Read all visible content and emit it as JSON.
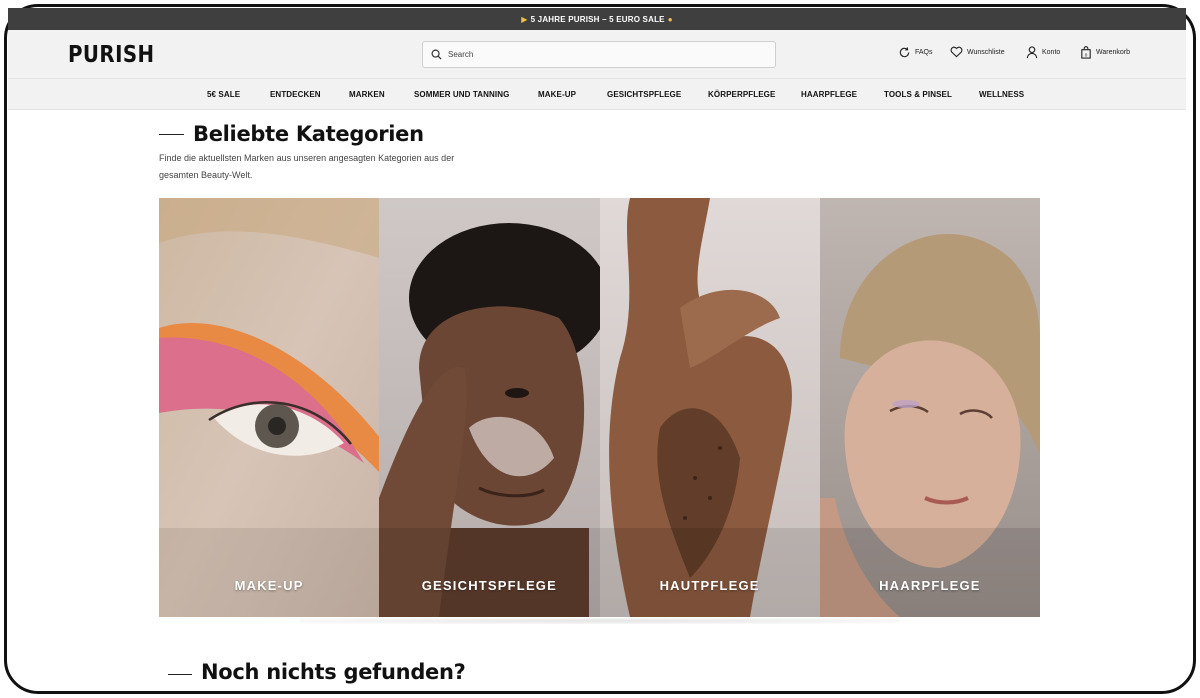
{
  "announcement": {
    "text": "5 JAHRE PURISH – 5 EURO SALE",
    "left_icon": "party-popper-icon",
    "right_icon": "money-icon"
  },
  "header": {
    "logo": "PURISH",
    "search": {
      "placeholder": "Search",
      "value": ""
    },
    "utilities": [
      {
        "label": "FAQs",
        "icon": "refresh-chat-icon"
      },
      {
        "label": "Wunschliste",
        "icon": "heart-icon"
      },
      {
        "label": "Konto",
        "icon": "user-icon"
      },
      {
        "label": "Warenkorb",
        "icon": "shopping-bag-icon"
      }
    ]
  },
  "nav": {
    "items": [
      "5€ SALE",
      "ENTDECKEN",
      "MARKEN",
      "SOMMER UND TANNING",
      "MAKE-UP",
      "GESICHTSPFLEGE",
      "KÖRPERPFLEGE",
      "HAARPFLEGE",
      "TOOLS & PINSEL",
      "WELLNESS"
    ]
  },
  "categories": {
    "title": "Beliebte Kategorien",
    "subtitle": "Finde die aktuellsten Marken aus unseren angesagten Kategorien aus der gesamten Beauty-Welt.",
    "tiles": [
      {
        "label": "MAKE-UP"
      },
      {
        "label": "GESICHTSPFLEGE"
      },
      {
        "label": "HAUTPFLEGE"
      },
      {
        "label": "HAARPFLEGE"
      }
    ]
  },
  "next_section": {
    "title": "Noch nichts gefunden?"
  },
  "colors": {
    "announcement_bg": "#3f3f3f",
    "header_bg": "#f2f2f2",
    "text": "#111111",
    "accent_gold": "#f1c04a"
  }
}
